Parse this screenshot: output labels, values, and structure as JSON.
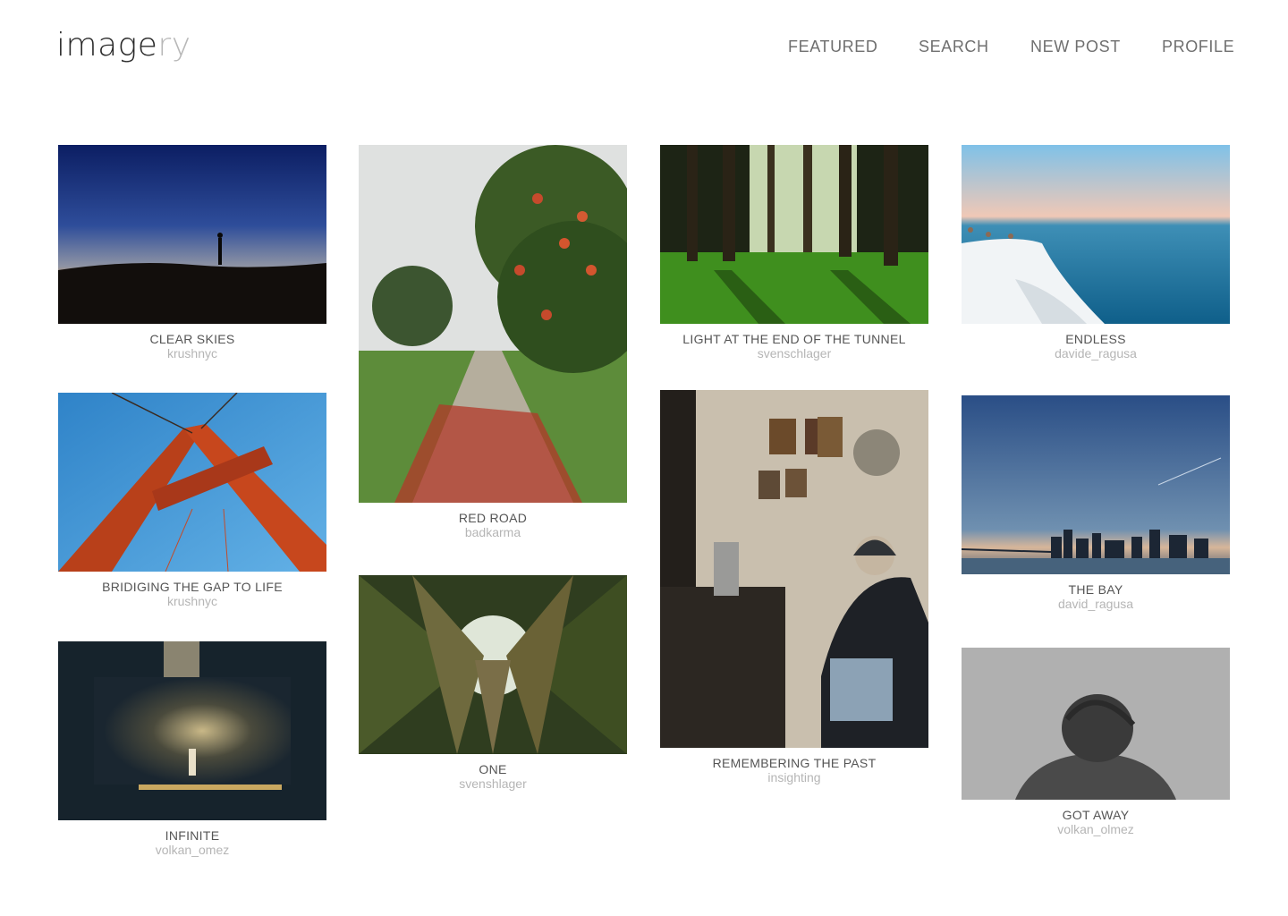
{
  "header": {
    "logo_main": "image",
    "logo_accent": "ry",
    "nav": [
      "FEATURED",
      "SEARCH",
      "NEW POST",
      "PROFILE"
    ]
  },
  "posts": [
    {
      "title": "CLEAR SKIES",
      "author": "krushnyc",
      "scene": "sunset silhouette"
    },
    {
      "title": "BRIDIGING THE GAP TO LIFE",
      "author": "krushnyc",
      "scene": "red bridge tower"
    },
    {
      "title": "INFINITE",
      "author": "volkan_omez",
      "scene": "light on wall"
    },
    {
      "title": "RED ROAD",
      "author": "badkarma",
      "scene": "road with red blossoms"
    },
    {
      "title": "ONE",
      "author": "svenshlager",
      "scene": "forest looking up"
    },
    {
      "title": "LIGHT AT THE END OF THE TUNNEL",
      "author": "svenschlager",
      "scene": "sunlit forest"
    },
    {
      "title": "REMEMBERING THE PAST",
      "author": "insighting",
      "scene": "elderly woman indoors"
    },
    {
      "title": "ENDLESS",
      "author": "davide_ragusa",
      "scene": "white cliffs and sea"
    },
    {
      "title": "THE BAY",
      "author": "david_ragusa",
      "scene": "city skyline at dusk"
    },
    {
      "title": "GOT AWAY",
      "author": "volkan_olmez",
      "scene": "grey portrait"
    }
  ]
}
